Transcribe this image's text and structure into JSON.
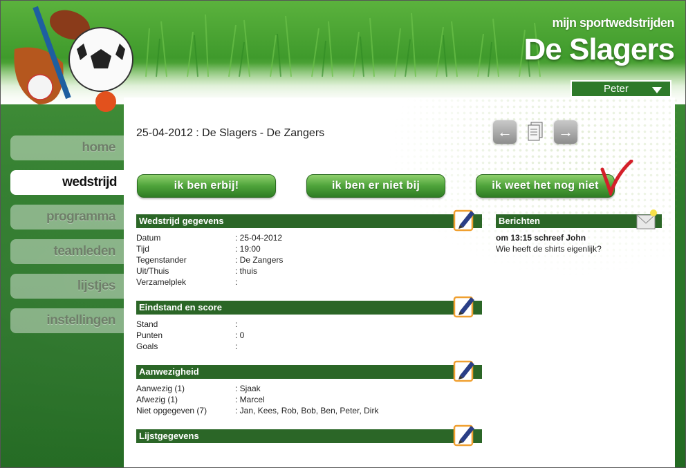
{
  "brand": {
    "tagline": "mijn sportwedstrijden",
    "team": "De Slagers"
  },
  "user": {
    "name": "Peter"
  },
  "nav": [
    {
      "label": "home"
    },
    {
      "label": "wedstrijd",
      "active": true
    },
    {
      "label": "programma"
    },
    {
      "label": "teamleden"
    },
    {
      "label": "lijstjes"
    },
    {
      "label": "instellingen"
    }
  ],
  "page": {
    "title": "25-04-2012 : De Slagers - De Zangers"
  },
  "icons": {
    "prev": "arrow-left-icon",
    "doc": "document-icon",
    "next": "arrow-right-icon"
  },
  "buttons": {
    "attending": "ik ben erbij!",
    "not_attending": "ik ben er niet bij",
    "unknown": "ik weet het nog niet"
  },
  "sections": {
    "match": {
      "title": "Wedstrijd gegevens",
      "rows": [
        {
          "label": "Datum",
          "value": ": 25-04-2012"
        },
        {
          "label": "Tijd",
          "value": ": 19:00"
        },
        {
          "label": "Tegenstander",
          "value": ": De Zangers"
        },
        {
          "label": "Uit/Thuis",
          "value": ": thuis"
        },
        {
          "label": "Verzamelplek",
          "value": ":"
        }
      ]
    },
    "score": {
      "title": "Eindstand en score",
      "rows": [
        {
          "label": "Stand",
          "value": ":"
        },
        {
          "label": "Punten",
          "value": ": 0"
        },
        {
          "label": "Goals",
          "value": ":"
        }
      ]
    },
    "attendance": {
      "title": "Aanwezigheid",
      "rows": [
        {
          "label": "Aanwezig (1)",
          "value": ": Sjaak"
        },
        {
          "label": "Afwezig (1)",
          "value": ": Marcel"
        },
        {
          "label": "Niet opgegeven (7)",
          "value": ": Jan, Kees, Rob, Bob, Ben, Peter, Dirk"
        }
      ]
    },
    "lists": {
      "title": "Lijstgegevens"
    }
  },
  "messages": {
    "title": "Berichten",
    "items": [
      {
        "header": "om 13:15 schreef John",
        "text": "Wie heeft de shirts eigenlijk?"
      }
    ]
  },
  "colors": {
    "header_green": "#2b6627",
    "button_green": "#4ea33a",
    "accent_red": "#d4202a"
  }
}
